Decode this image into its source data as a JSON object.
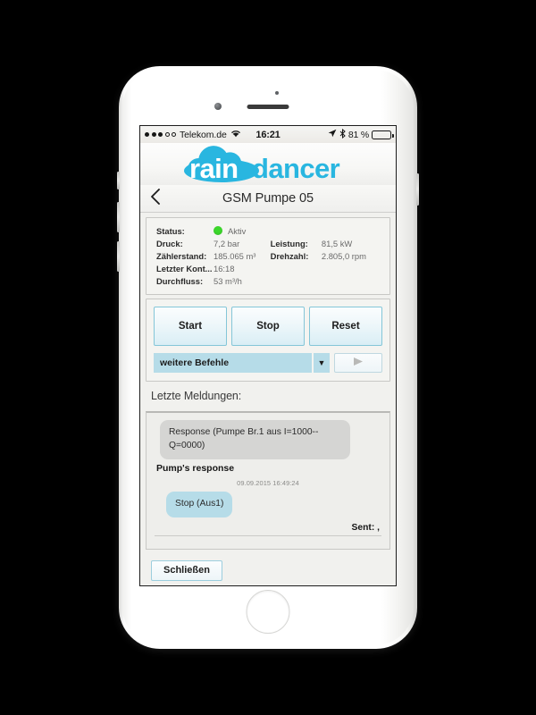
{
  "statusbar": {
    "carrier": "Telekom.de",
    "time": "16:21",
    "battery_percent": "81 %",
    "signal_filled": 3,
    "signal_total": 5,
    "icons": [
      "wifi-icon",
      "location-arrow-icon",
      "bluetooth-icon",
      "battery-icon"
    ]
  },
  "brand": {
    "name": "raindancer",
    "part_light": "rain",
    "part_dark": "dancer",
    "color": "#29b6e0"
  },
  "navbar": {
    "back_icon": "chevron-left-icon",
    "title": "GSM Pumpe 05"
  },
  "details": {
    "rows": [
      {
        "label": "Status:",
        "value": "Aktiv",
        "has_dot": true,
        "dot_color": "#3cd72b"
      },
      {
        "label": "Druck:",
        "value": "7,2 bar",
        "label2": "Leistung:",
        "value2": "81,5 kW"
      },
      {
        "label": "Zählerstand:",
        "value": "185.065 m³",
        "label2": "Drehzahl:",
        "value2": "2.805,0 rpm"
      },
      {
        "label": "Letzter Kont...",
        "value": "16:18"
      },
      {
        "label": "Durchfluss:",
        "value": "53 m³/h"
      }
    ]
  },
  "commands": {
    "buttons": [
      "Start",
      "Stop",
      "Reset"
    ],
    "select_value": "weitere Befehle",
    "select_arrow_icon": "chevron-down-icon",
    "send_icon": "send-triangle-icon"
  },
  "messages": {
    "title": "Letzte Meldungen:",
    "items": [
      {
        "kind": "bubble-grey",
        "text": "Response (Pumpe Br.1 aus I=1000--Q=0000)"
      },
      {
        "kind": "label",
        "text": "Pump's response"
      },
      {
        "kind": "time",
        "text": "09.09.2015 16:49:24"
      },
      {
        "kind": "bubble-blue",
        "text": "Stop (Aus1)"
      }
    ],
    "sent_line": "Sent: ,"
  },
  "footer": {
    "close_label": "Schließen"
  },
  "colors": {
    "accent": "#29b6e0",
    "bubble_blue": "#b6dce8",
    "bubble_grey": "#d5d5d3",
    "status_green": "#3cd72b"
  }
}
